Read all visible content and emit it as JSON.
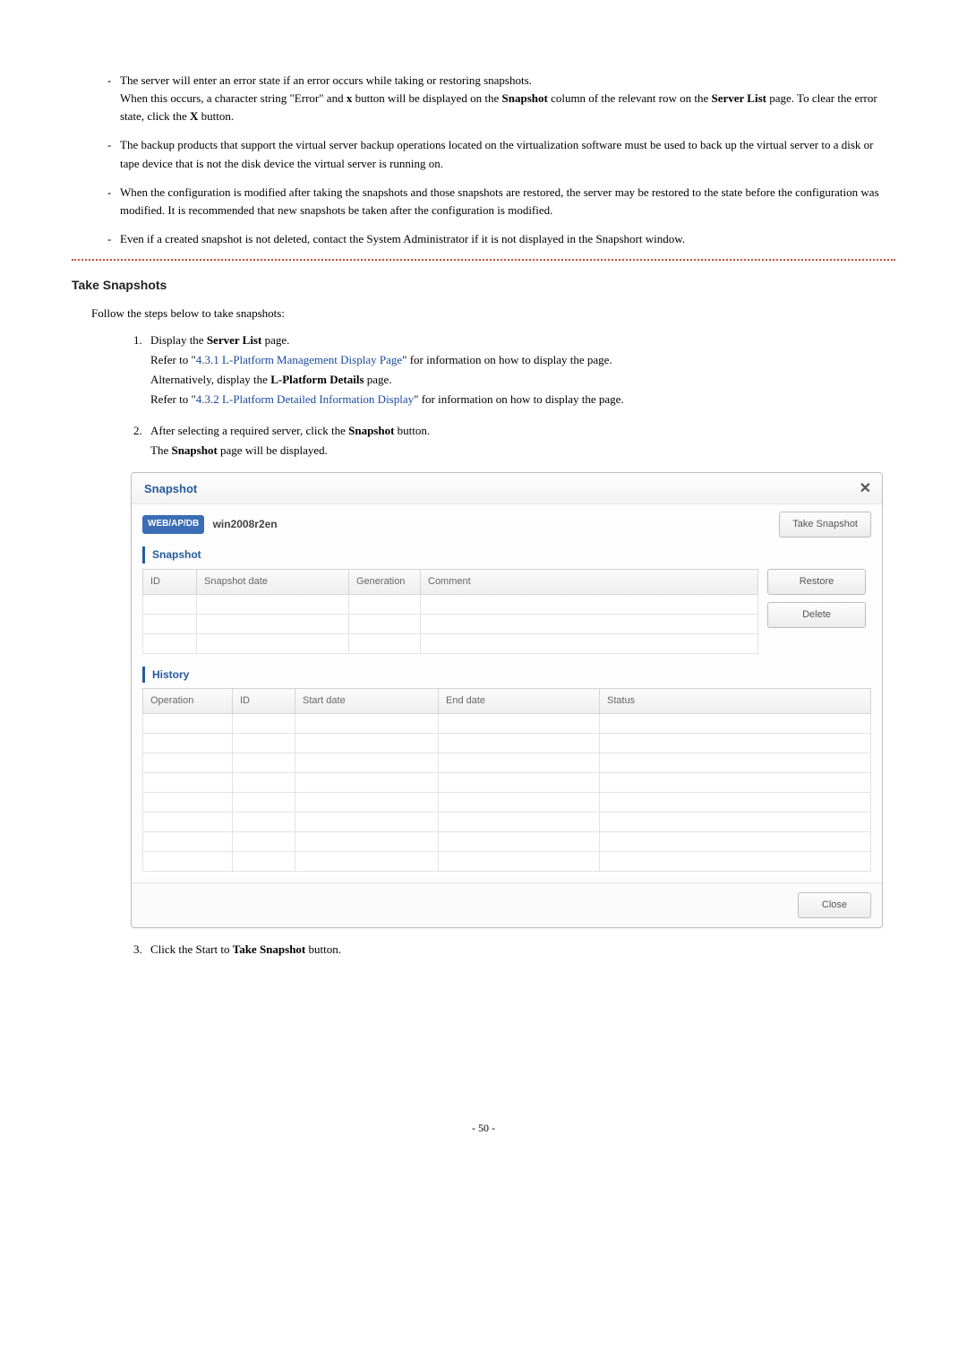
{
  "notes": {
    "items": [
      {
        "line1": "The server will enter an error state if an error occurs while taking or restoring snapshots.",
        "line2_a": "When this occurs, a character string \"Error\" and ",
        "line2_b": "x",
        "line2_c": " button will be displayed on the ",
        "line2_d": "Snapshot",
        "line2_e": " column of the relevant row on the ",
        "line2_f": "Server List",
        "line2_g": " page. To clear the error state, click the ",
        "line2_h": "X",
        "line2_i": " button."
      },
      {
        "text": "The backup products that support the virtual server backup operations located on the virtualization software must be used to back up the virtual server to a disk or tape device that is not the disk device the virtual server is running on."
      },
      {
        "text": "When the configuration is modified after taking the snapshots and those snapshots are restored, the server may be restored to the state before the configuration was modified. It is recommended that new snapshots be taken after the configuration is modified."
      },
      {
        "text": "Even if a created snapshot is not deleted, contact the System Administrator if it is not displayed in the Snapshort window."
      }
    ]
  },
  "subhead": "Take Snapshots",
  "intro": "Follow the steps below to take snapshots:",
  "steps": {
    "s1": {
      "l1a": "Display the ",
      "l1b": "Server List",
      "l1c": " page.",
      "l2a": "Refer to \"",
      "l2b": "4.3.1 L-Platform Management Display Page",
      "l2c": "\" for information on how to display the page.",
      "l3a": "Alternatively, display the ",
      "l3b": "L-Platform Details",
      "l3c": " page.",
      "l4a": "Refer to \"",
      "l4b": "4.3.2 L-Platform Detailed Information Display",
      "l4c": "\" for information on how to display the page."
    },
    "s2": {
      "l1a": "After selecting a required server, click the ",
      "l1b": "Snapshot",
      "l1c": " button.",
      "l2a": "The ",
      "l2b": "Snapshot",
      "l2c": " page will be displayed."
    },
    "s3": {
      "l1a": "Click the Start to ",
      "l1b": "Take Snapshot",
      "l1c": " button."
    }
  },
  "dialog": {
    "title": "Snapshot",
    "badge": "WEB/AP/DB",
    "server": "win2008r2en",
    "btn_take": "Take Snapshot",
    "section_snapshot": "Snapshot",
    "btn_restore": "Restore",
    "btn_delete": "Delete",
    "snap_cols": {
      "id": "ID",
      "date": "Snapshot date",
      "gen": "Generation",
      "comment": "Comment"
    },
    "section_history": "History",
    "hist_cols": {
      "op": "Operation",
      "id": "ID",
      "start": "Start date",
      "end": "End date",
      "status": "Status"
    },
    "btn_close": "Close"
  },
  "page_num": "- 50 -"
}
